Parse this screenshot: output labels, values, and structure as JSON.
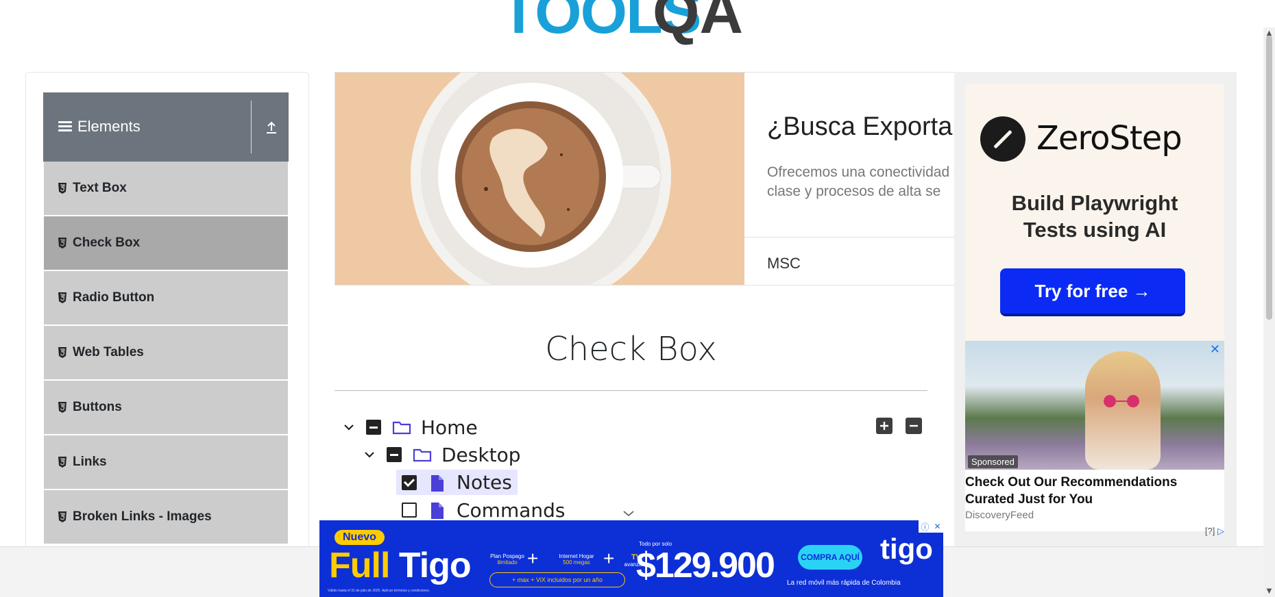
{
  "logo": {
    "text": "TOOLS",
    "accent": "QA"
  },
  "sidebar": {
    "group_title": "Elements",
    "items": [
      {
        "label": "Text Box",
        "active": false
      },
      {
        "label": "Check Box",
        "active": true
      },
      {
        "label": "Radio Button",
        "active": false
      },
      {
        "label": "Web Tables",
        "active": false
      },
      {
        "label": "Buttons",
        "active": false
      },
      {
        "label": "Links",
        "active": false
      },
      {
        "label": "Broken Links - Images",
        "active": false
      }
    ]
  },
  "banner_ad": {
    "title": "¿Busca Exportar",
    "description": "Ofrecemos una conectividad de clase y procesos de alta se",
    "brand": "MSC"
  },
  "main": {
    "page_title": "Check Box",
    "tree": [
      {
        "label": "Home",
        "state": "half",
        "expanded": true,
        "type": "folder"
      },
      {
        "label": "Desktop",
        "state": "half",
        "expanded": true,
        "type": "folder"
      },
      {
        "label": "Notes",
        "state": "checked",
        "type": "file"
      },
      {
        "label": "Commands",
        "state": "unchecked",
        "type": "file"
      }
    ],
    "expand_all_icon": "plus-square-icon",
    "collapse_all_icon": "minus-square-icon"
  },
  "right_ad": {
    "brand": "ZeroStep",
    "tagline_line1": "Build Playwright",
    "tagline_line2": "Tests using AI",
    "cta": "Try for free →"
  },
  "sponsored": {
    "badge": "Sponsored",
    "headline_line1": "Check Out Our Recommendations",
    "headline_line2": "Curated Just for You",
    "source": "DiscoveryFeed",
    "adchoices": "[?]"
  },
  "bottom_ad": {
    "badge": "Nuevo",
    "title_a": "Full",
    "title_b": "Tigo",
    "plan_line1": "Plan Pospago",
    "plan_line2": "ilimitado",
    "internet_line1": "Internet Hogar",
    "internet_line2": "500 megas",
    "tv_line1": "TV",
    "tv_line2": "avanzada",
    "pill_text": "+ max + ViX incluidos por un año",
    "todo": "Todo por solo",
    "price": "$129.900",
    "cta": "COMPRA AQUÍ",
    "brand": "tigo",
    "tagline": "La red móvil más rápida de Colombia",
    "fine_print": "Válido hasta el 31 de julio de 2025. Aplican términos y condiciones."
  },
  "colors": {
    "sidebar_header": "#6c757d",
    "menu_item": "#cccccc",
    "menu_item_active": "#a9a9a9",
    "folder_icon": "#4a3fd6",
    "cta_blue": "#0b2bf5",
    "tigo_blue": "#0d2fd6"
  }
}
